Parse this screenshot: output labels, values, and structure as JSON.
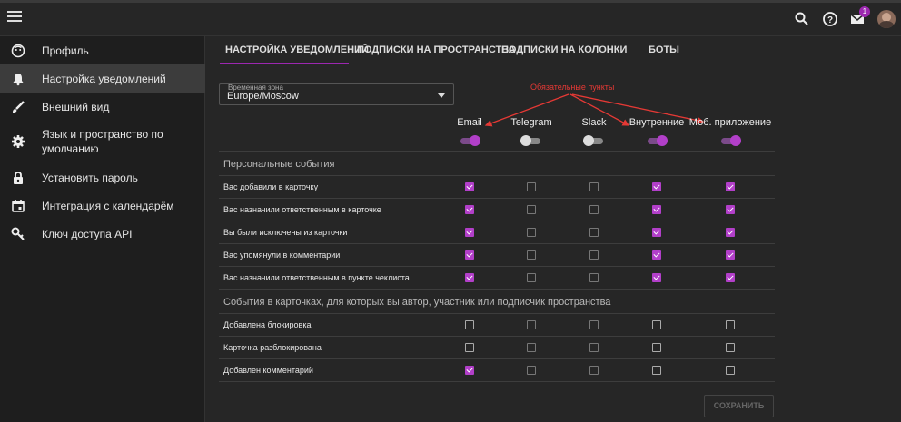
{
  "topbar": {
    "notification_count": "1",
    "icons": [
      "menu-icon",
      "search-icon",
      "help-icon",
      "mail-icon",
      "avatar"
    ]
  },
  "sidebar": {
    "items": [
      {
        "label": "Профиль",
        "icon": "smile-icon"
      },
      {
        "label": "Настройка уведомлений",
        "icon": "bell-icon",
        "active": true
      },
      {
        "label": "Внешний вид",
        "icon": "brush-icon"
      },
      {
        "label": "Язык и пространство по умолчанию",
        "icon": "gear-icon"
      },
      {
        "label": "Установить пароль",
        "icon": "lock-icon"
      },
      {
        "label": "Интеграция с календарём",
        "icon": "calendar-icon"
      },
      {
        "label": "Ключ доступа API",
        "icon": "key-icon"
      }
    ]
  },
  "tabs": [
    {
      "label": "НАСТРОЙКА УВЕДОМЛЕНИЙ",
      "active": true
    },
    {
      "label": "ПОДПИСКИ НА ПРОСТРАНСТВА"
    },
    {
      "label": "ПОДПИСКИ НА КОЛОНКИ"
    },
    {
      "label": "БОТЫ"
    }
  ],
  "timezone": {
    "label": "Временная зона",
    "value": "Europe/Moscow"
  },
  "annotation": "Обязательные пункты",
  "columns": [
    {
      "label": "Email",
      "enabled": true
    },
    {
      "label": "Telegram",
      "enabled": false
    },
    {
      "label": "Slack",
      "enabled": false
    },
    {
      "label": "Внутренние",
      "enabled": true
    },
    {
      "label": "Моб. приложение",
      "enabled": true
    }
  ],
  "sections": [
    {
      "title": "Персональные события",
      "rows": [
        {
          "label": "Вас добавили в карточку",
          "checks": [
            true,
            false,
            false,
            true,
            true
          ]
        },
        {
          "label": "Вас назначили ответственным в карточке",
          "checks": [
            true,
            false,
            false,
            true,
            true
          ]
        },
        {
          "label": "Вы были исключены из карточки",
          "checks": [
            true,
            false,
            false,
            true,
            true
          ]
        },
        {
          "label": "Вас упомянули в комментарии",
          "checks": [
            true,
            false,
            false,
            true,
            true
          ]
        },
        {
          "label": "Вас назначили ответственным в пункте чеклиста",
          "checks": [
            true,
            false,
            false,
            true,
            true
          ]
        }
      ]
    },
    {
      "title": "События в карточках, для которых вы автор, участник или подписчик пространства",
      "rows": [
        {
          "label": "Добавлена блокировка",
          "checks": [
            false,
            false,
            false,
            false,
            false
          ]
        },
        {
          "label": "Карточка разблокирована",
          "checks": [
            false,
            false,
            false,
            false,
            false
          ]
        },
        {
          "label": "Добавлен комментарий",
          "checks": [
            true,
            false,
            false,
            false,
            false
          ]
        }
      ]
    }
  ],
  "save_label": "СОХРАНИТЬ",
  "colors": {
    "accent": "#b23fc9",
    "annotation": "#e53935",
    "tab_underline": "#9c27b0"
  }
}
